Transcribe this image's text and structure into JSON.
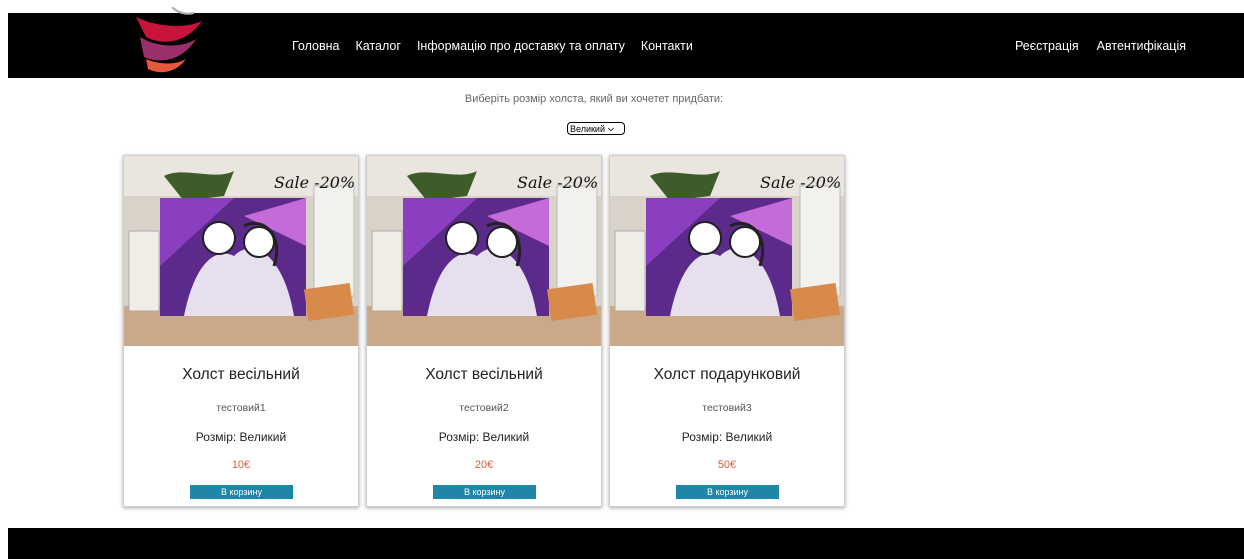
{
  "header": {
    "nav": [
      "Головна",
      "Каталог",
      "Інформацію про доставку та оплату",
      "Контакти"
    ],
    "auth": [
      "Реєстрація",
      "Автентифікація"
    ]
  },
  "size_picker": {
    "prompt": "Виберіть розмір холста, який ви хочетет придбати:",
    "selected": "Великий"
  },
  "products": [
    {
      "title": "Холст весільний",
      "description": "тестовий1",
      "size": "Розмір: Великий",
      "price": "10€",
      "button": "В корзину",
      "banner": "Sale -20%"
    },
    {
      "title": "Холст весільний",
      "description": "тестовий2",
      "size": "Розмір: Великий",
      "price": "20€",
      "button": "В корзину",
      "banner": "Sale -20%"
    },
    {
      "title": "Холст подарунковий",
      "description": "тестовий3",
      "size": "Розмір: Великий",
      "price": "50€",
      "button": "В корзину",
      "banner": "Sale -20%"
    }
  ],
  "colors": {
    "header_bg": "#000000",
    "button_bg": "#1f86a8",
    "price": "#e05a3a"
  }
}
